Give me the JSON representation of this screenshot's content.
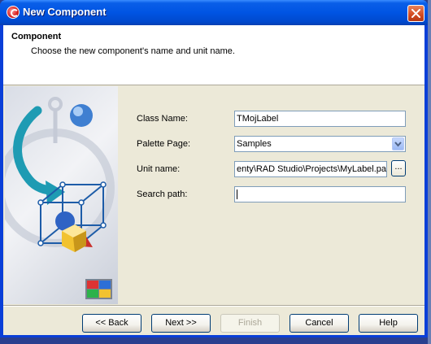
{
  "window": {
    "title": "New Component",
    "accent": "#0054e3",
    "close_icon": "close-icon"
  },
  "header": {
    "title": "Component",
    "subtitle": "Choose the new component's name and unit name."
  },
  "form": {
    "class_name": {
      "label": "Class Name:",
      "value": "TMojLabel"
    },
    "palette_page": {
      "label": "Palette Page:",
      "value": "Samples"
    },
    "unit_name": {
      "label": "Unit name:",
      "value": "enty\\RAD Studio\\Projects\\MyLabel.pa",
      "browse_label": "..."
    },
    "search_path": {
      "label": "Search path:",
      "value": ""
    }
  },
  "buttons": {
    "back": "<< Back",
    "next": "Next >>",
    "finish": "Finish",
    "cancel": "Cancel",
    "help": "Help"
  }
}
